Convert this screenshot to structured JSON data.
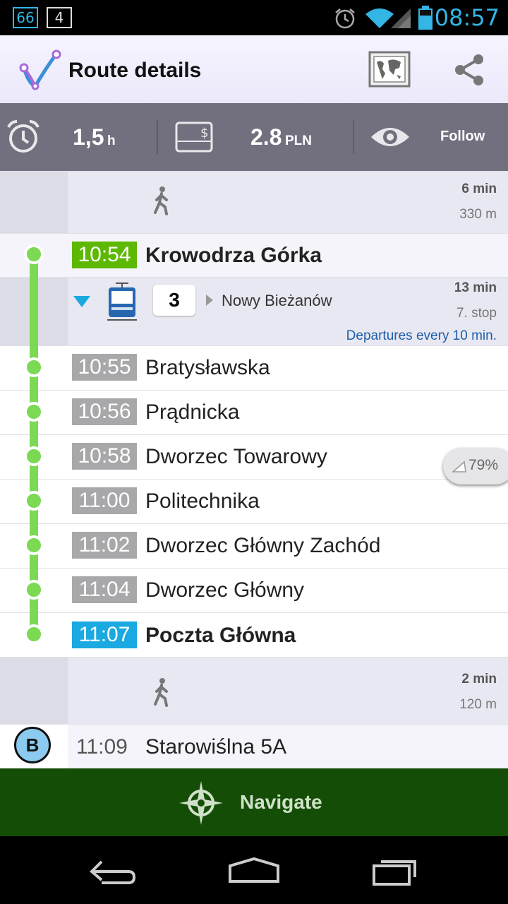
{
  "status_bar": {
    "notif1": "66",
    "notif2": "4",
    "time": "08:57",
    "icons": [
      "alarm-icon",
      "wifi-icon",
      "signal-icon",
      "battery-icon"
    ]
  },
  "action_bar": {
    "title": "Route details",
    "icons": [
      "route-logo-icon",
      "map-icon",
      "share-icon"
    ]
  },
  "summary": {
    "duration_value": "1,5",
    "duration_unit": "h",
    "price_value": "2.8",
    "price_unit": "PLN",
    "follow_label": "Follow"
  },
  "walk1": {
    "duration": "6 min",
    "distance": "330 m"
  },
  "first_stop": {
    "time": "10:54",
    "name": "Krowodrza Górka"
  },
  "transit": {
    "line": "3",
    "direction": "Nowy Bieżanów",
    "duration": "13 min",
    "stops": "7. stop",
    "frequency": "Departures every 10 min."
  },
  "stops": [
    {
      "time": "10:55",
      "name": "Bratysławska"
    },
    {
      "time": "10:56",
      "name": "Prądnicka"
    },
    {
      "time": "10:58",
      "name": "Dworzec Towarowy"
    },
    {
      "time": "11:00",
      "name": "Politechnika"
    },
    {
      "time": "11:02",
      "name": "Dworzec Główny Zachód"
    },
    {
      "time": "11:04",
      "name": "Dworzec Główny"
    }
  ],
  "last_stop": {
    "time": "11:07",
    "name": "Poczta Główna"
  },
  "crowd_badge": "79%",
  "walk2": {
    "duration": "2 min",
    "distance": "120 m"
  },
  "destination": {
    "marker": "B",
    "time": "11:09",
    "name": "Starowiślna 5A"
  },
  "navigate_label": "Navigate",
  "colors": {
    "start_badge": "#5cb800",
    "end_badge": "#1aa9e0",
    "stop_badge": "#a8a8aa",
    "route_line": "#7bd954",
    "navigate_bg": "#144d06",
    "summary_bg": "#72707e",
    "link": "#1c5ea8"
  }
}
